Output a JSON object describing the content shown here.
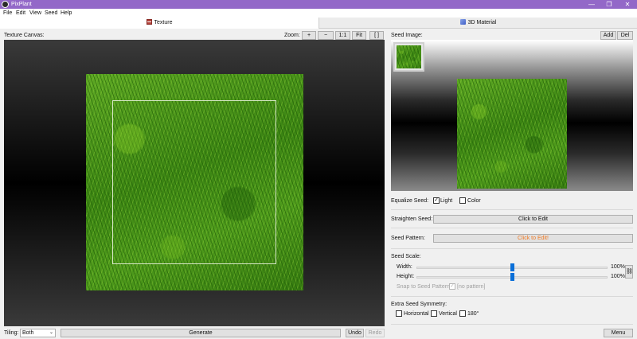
{
  "window": {
    "title": "PixPlant",
    "minimize": "—",
    "maximize": "❐",
    "close": "✕"
  },
  "menu": [
    "File",
    "Edit",
    "View",
    "Seed",
    "Help"
  ],
  "tabs": {
    "texture": "Texture",
    "material": "3D Material"
  },
  "canvas": {
    "label": "Texture Canvas:",
    "zoom_label": "Zoom:",
    "zoom_in": "+",
    "zoom_out": "−",
    "zoom_1to1": "1:1",
    "zoom_fit": "Fit",
    "zoom_brackets": "[  ]"
  },
  "bottom": {
    "tiling_label": "Tiling:",
    "tiling_value": "Both",
    "generate": "Generate",
    "undo": "Undo",
    "redo": "Redo"
  },
  "seed": {
    "image_label": "Seed Image:",
    "add": "Add",
    "del": "Del",
    "equalize_label": "Equalize Seed:",
    "light": "Light",
    "color": "Color",
    "straighten_label": "Straighten Seed:",
    "straighten_btn": "Click to Edit",
    "pattern_label": "Seed Pattern:",
    "pattern_btn": "Click to Edit!",
    "scale_label": "Seed Scale:",
    "width_label": "Width:",
    "width_value": "100%",
    "width_level": 0.5,
    "height_label": "Height:",
    "height_value": "100%",
    "height_level": 0.5,
    "snap_label": "Snap to Seed Pattern:",
    "no_pattern": "[no pattern]",
    "symmetry_label": "Extra Seed Symmetry:",
    "horizontal": "Horizontal",
    "vertical": "Vertical",
    "rot180": "180°",
    "menu": "Menu"
  }
}
